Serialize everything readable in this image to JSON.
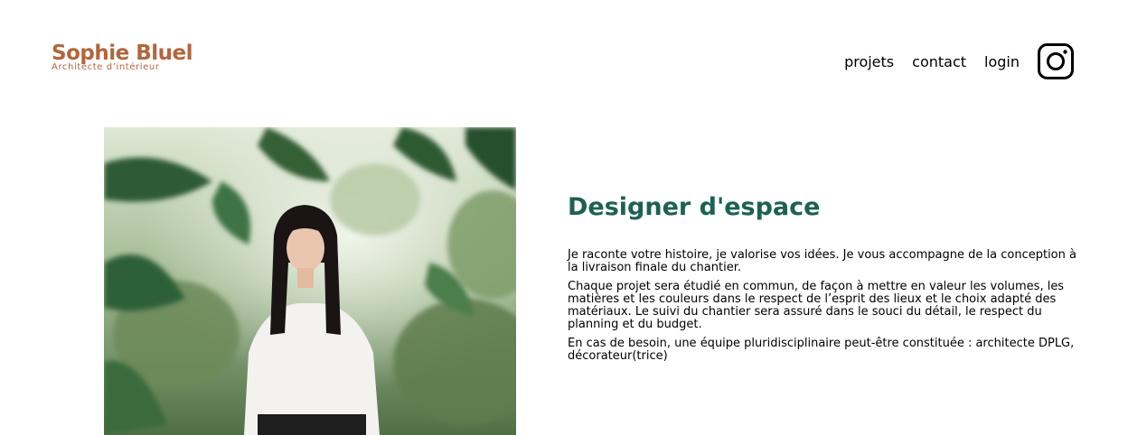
{
  "header": {
    "logo_title": "Sophie Bluel",
    "logo_subtitle": "Architecte d’intérieur",
    "brand_color": "#b1663c",
    "nav": {
      "projects": "projets",
      "contact": "contact",
      "login": "login"
    },
    "social_icon": "instagram-icon"
  },
  "introduction": {
    "title": "Designer d'espace",
    "title_color": "#1d6154",
    "paragraphs": [
      "Je raconte votre histoire, je valorise vos idées. Je vous accompagne de la conception à la livraison finale du chantier.",
      "Chaque projet sera étudié en commun, de façon à mettre en valeur les volumes, les matières et les couleurs dans le respect de l’esprit des lieux et le choix adapté des matériaux. Le suivi du chantier sera assuré dans le souci du détail, le respect du planning et du budget.",
      "En cas de besoin, une équipe pluridisciplinaire peut-être constituée : architecte DPLG, décorateur(trice)"
    ]
  }
}
